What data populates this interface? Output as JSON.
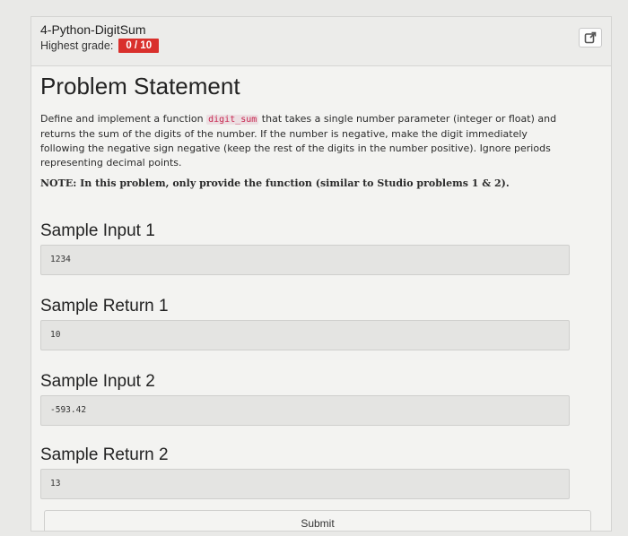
{
  "header": {
    "title": "4-Python-DigitSum",
    "grade_label": "Highest grade:",
    "grade_value": "0 / 10"
  },
  "problem": {
    "title": "Problem Statement",
    "desc_part1": "Define and implement a function ",
    "function_name": "digit_sum",
    "desc_part2": " that takes a single number parameter (integer or float) and returns the sum of the digits of the number. If the number is negative, make the digit immediately following the negative sign negative (keep the rest of the digits in the number positive). Ignore periods representing decimal points.",
    "note": "NOTE: In this problem, only provide the function (similar to Studio problems 1 & 2)."
  },
  "samples": [
    {
      "title": "Sample Input 1",
      "value": "1234"
    },
    {
      "title": "Sample Return 1",
      "value": "10"
    },
    {
      "title": "Sample Input 2",
      "value": "-593.42"
    },
    {
      "title": "Sample Return 2",
      "value": "13"
    }
  ],
  "submit_label": "Submit",
  "icons": {
    "refresh": "external-link-icon",
    "scroll_up": "triangle-up-icon",
    "scroll_down": "triangle-down-icon"
  }
}
